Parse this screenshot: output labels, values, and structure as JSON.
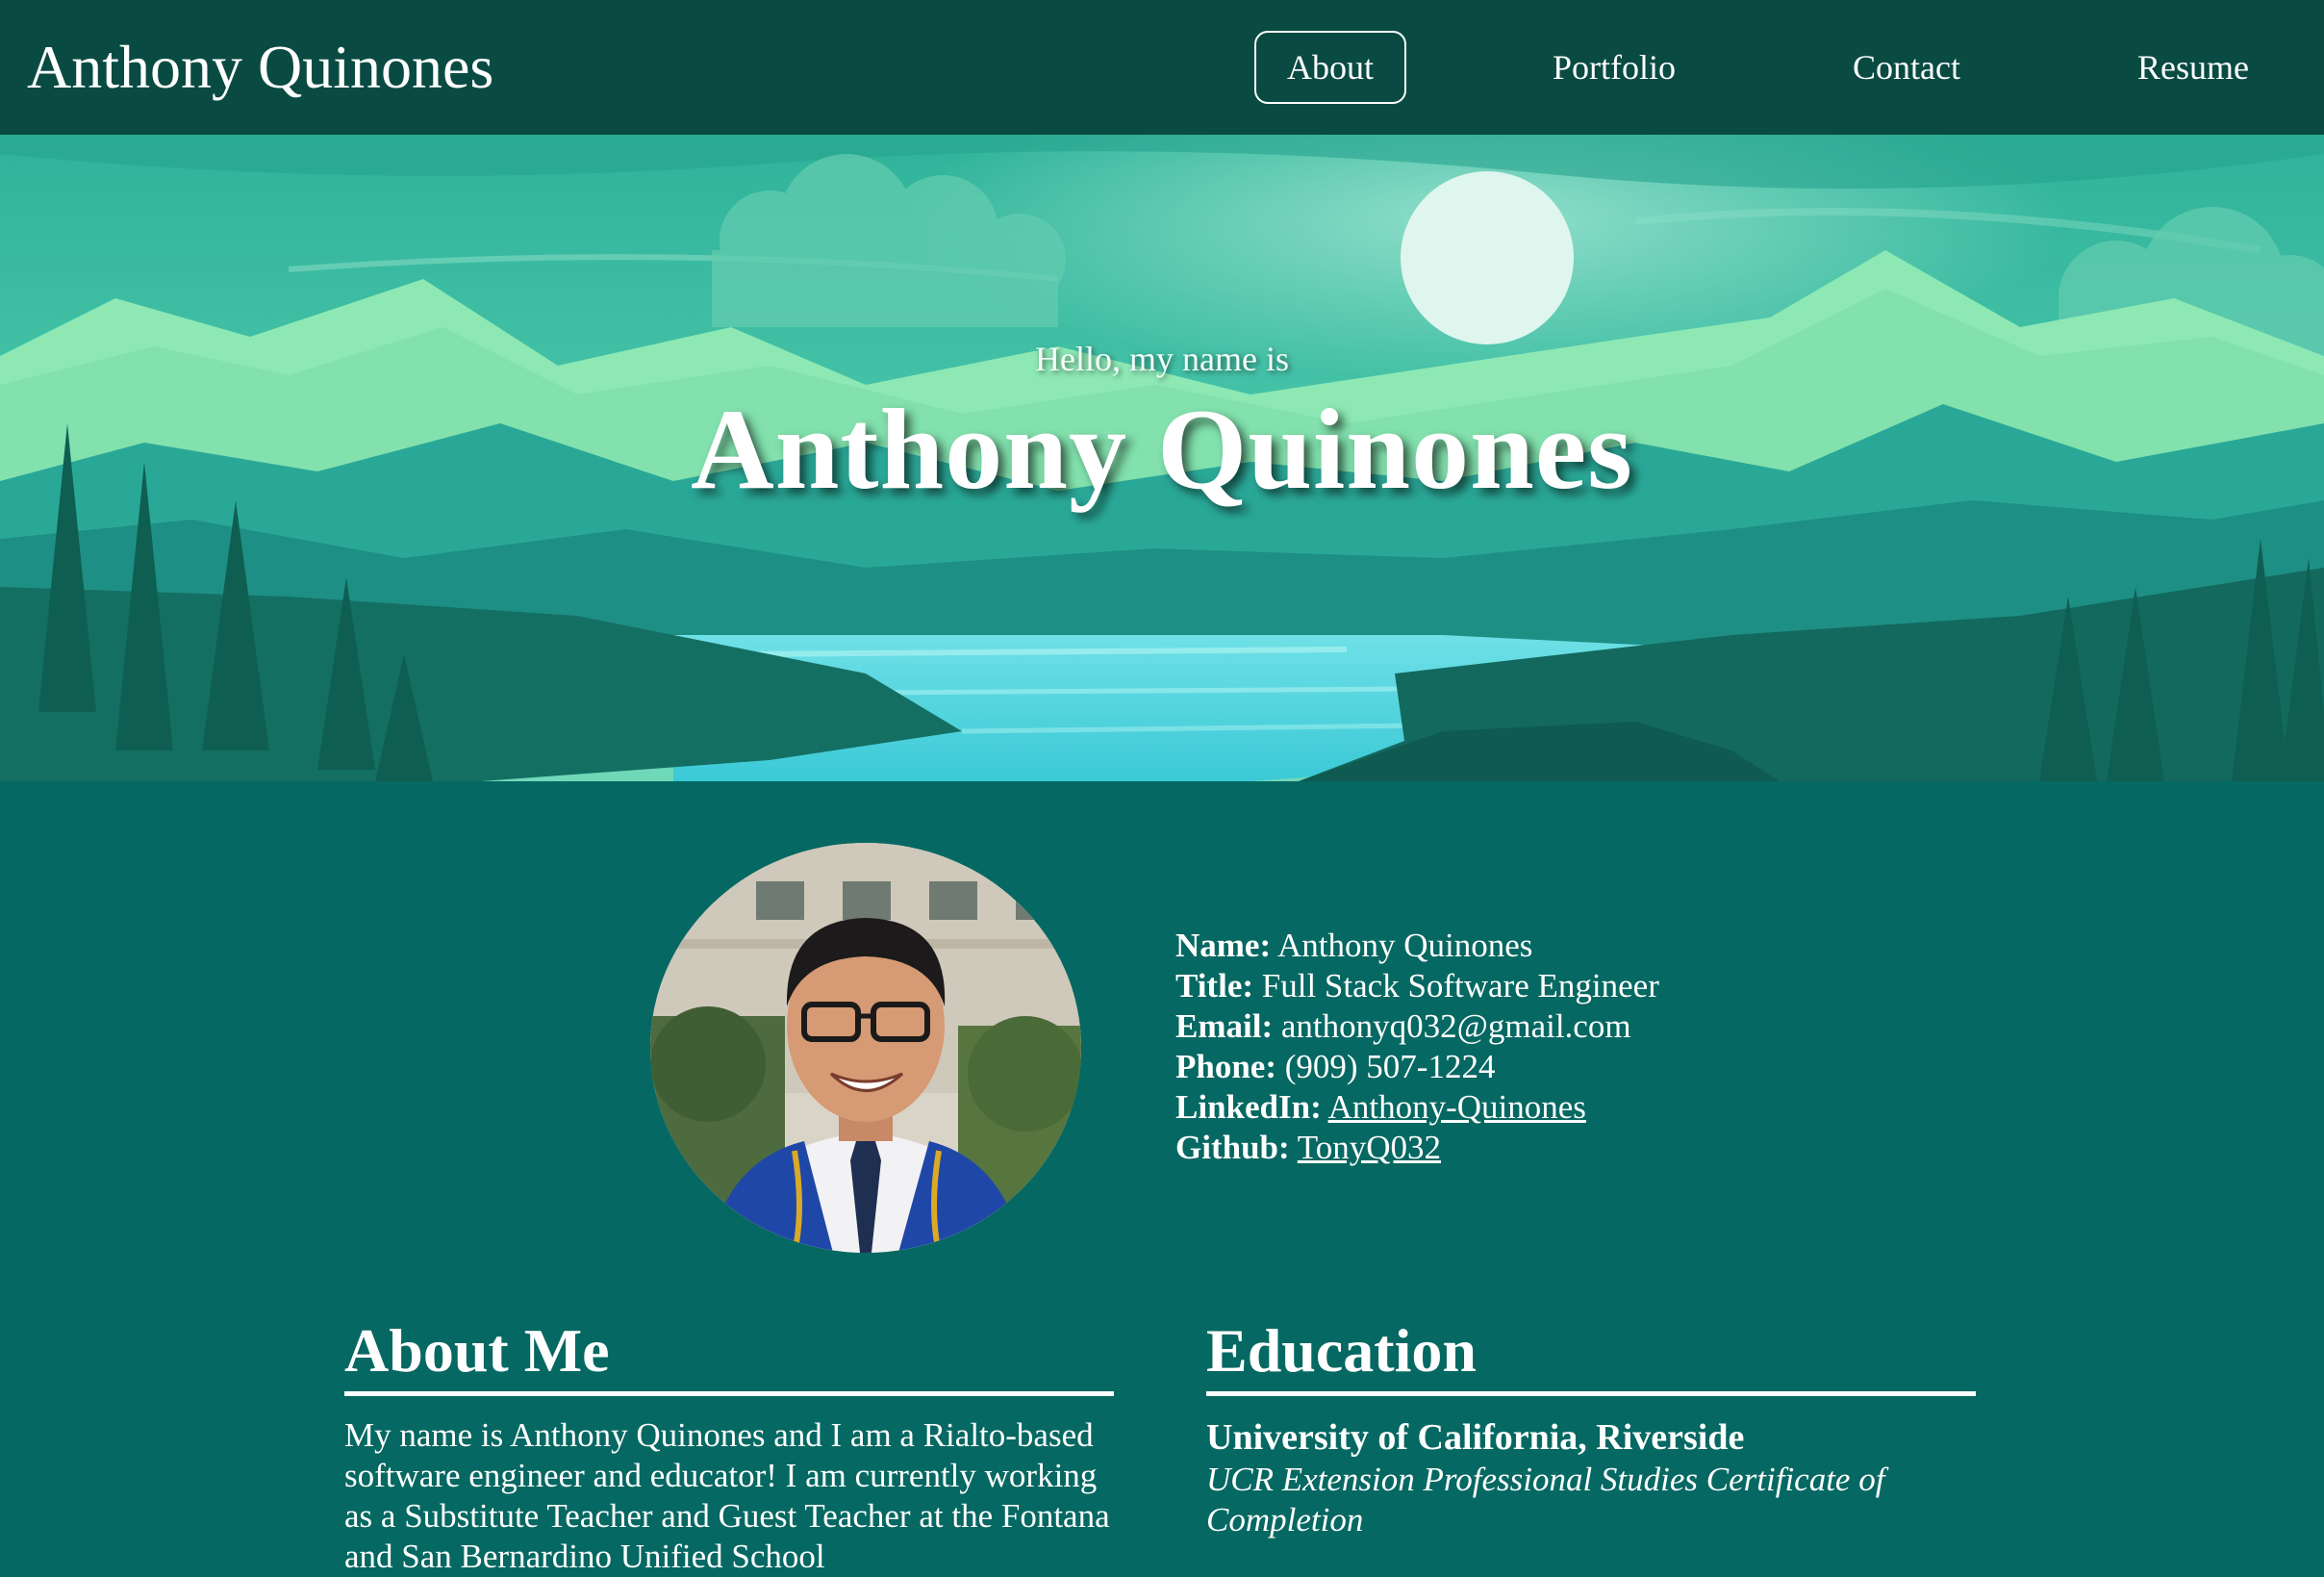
{
  "navbar": {
    "brand": "Anthony Quinones",
    "links": [
      {
        "label": "About",
        "active": true
      },
      {
        "label": "Portfolio",
        "active": false
      },
      {
        "label": "Contact",
        "active": false
      },
      {
        "label": "Resume",
        "active": false
      }
    ]
  },
  "hero": {
    "greeting": "Hello, my name is",
    "name": "Anthony Quinones"
  },
  "profile": {
    "fields": [
      {
        "label": "Name:",
        "value": "Anthony Quinones"
      },
      {
        "label": "Title:",
        "value": "Full Stack Software Engineer"
      },
      {
        "label": "Email:",
        "value": "anthonyq032@gmail.com"
      },
      {
        "label": "Phone:",
        "value": "(909) 507-1224"
      },
      {
        "label": "LinkedIn:",
        "value": "Anthony-Quinones"
      },
      {
        "label": "Github:",
        "value": "TonyQ032"
      }
    ]
  },
  "about": {
    "title": "About Me",
    "text": "My name is Anthony Quinones and I am a Rialto-based software engineer and educator! I am currently working as a Substitute Teacher and Guest Teacher at the Fontana and San Bernardino Unified School"
  },
  "education": {
    "title": "Education",
    "school": "University of California, Riverside",
    "degree": "UCR Extension Professional Studies Certificate of Completion"
  },
  "colors": {
    "navbar_bg": "#094b42",
    "page_bg": "#066862",
    "text": "#ffffff"
  }
}
